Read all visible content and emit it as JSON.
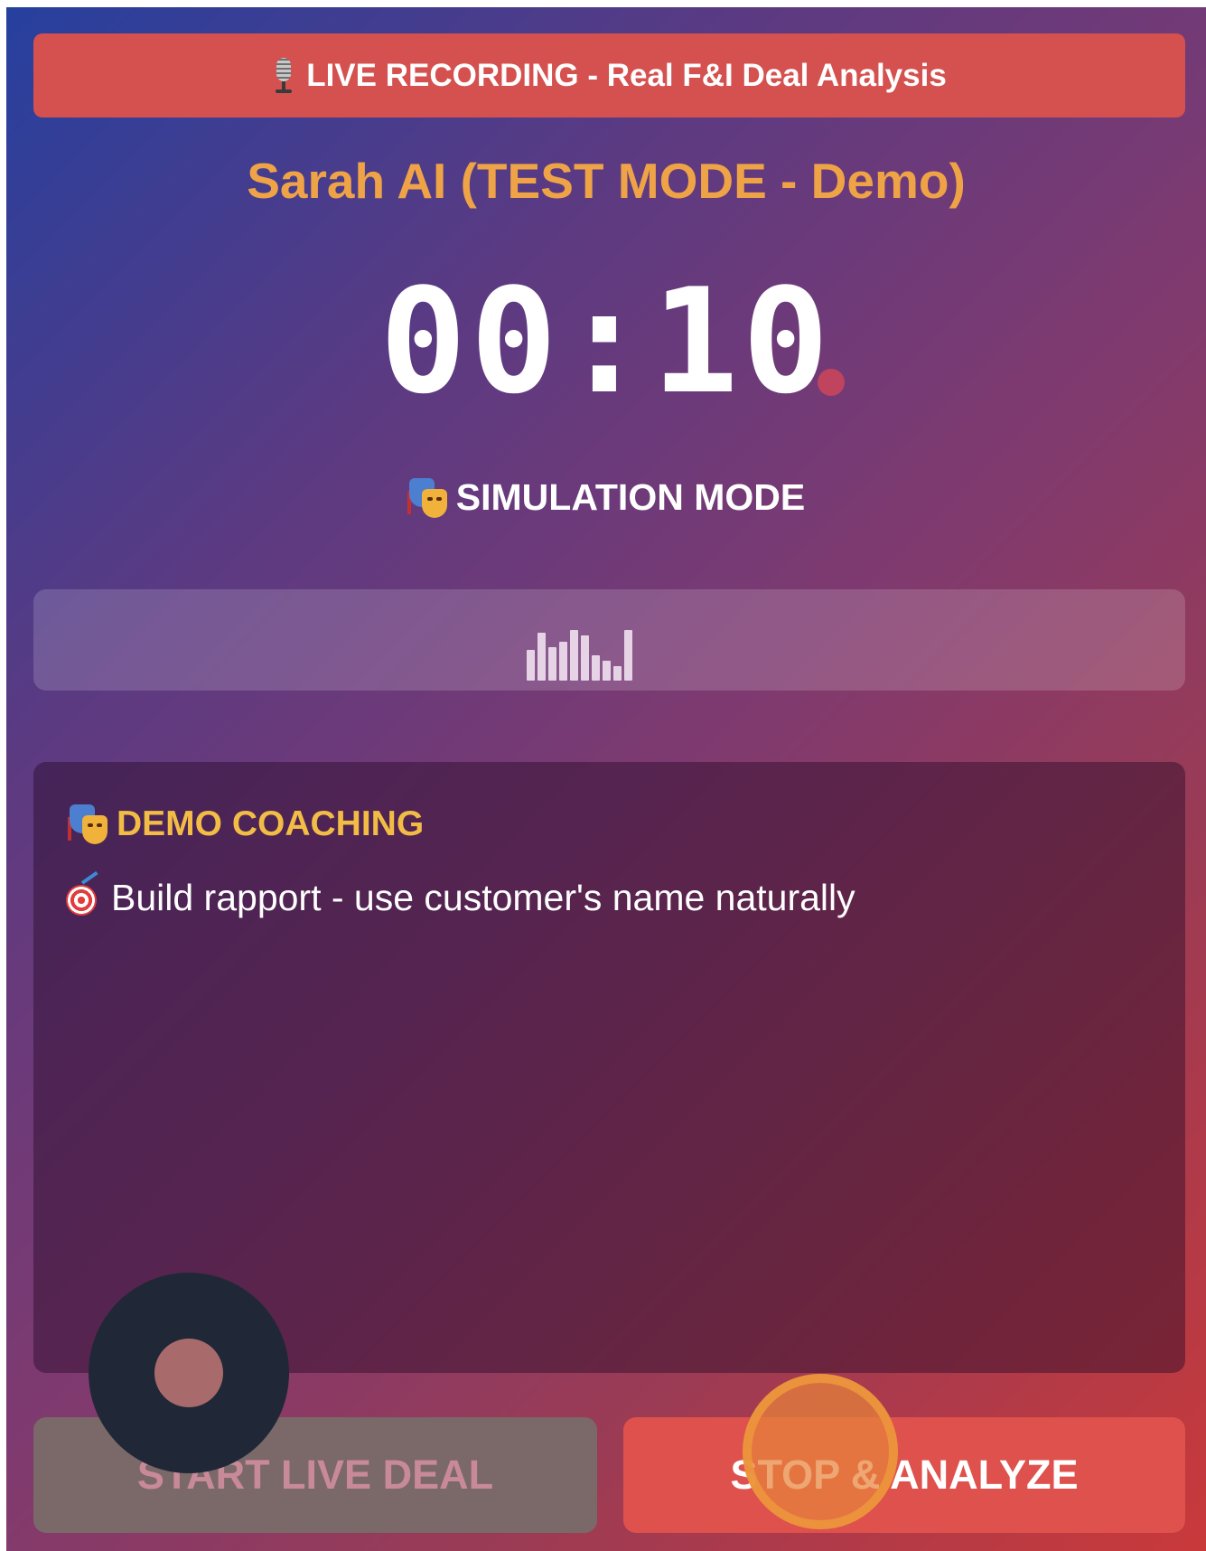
{
  "banner": {
    "icon": "microphone-icon",
    "text": "LIVE RECORDING - Real F&I Deal Analysis",
    "color": "#d4514f"
  },
  "agent": {
    "title": "Sarah AI (TEST MODE - Demo)",
    "color": "#efa347"
  },
  "timer": {
    "value": "00:10",
    "recording_indicator": "recording-dot"
  },
  "mode": {
    "icon": "performing-arts-masks-icon",
    "label": "SIMULATION MODE"
  },
  "audio_meter": {
    "levels": [
      0.55,
      0.85,
      0.6,
      0.7,
      0.9,
      0.8,
      0.45,
      0.35,
      0.25,
      0.9
    ]
  },
  "coaching": {
    "icon": "performing-arts-masks-icon",
    "title": "DEMO COACHING",
    "tip_icon": "target-dart-icon",
    "tip": "Build rapport - use customer's name naturally"
  },
  "actions": {
    "start_label": "START LIVE DEAL",
    "stop_label": "STOP & ANALYZE",
    "stop_color": "#de514c"
  },
  "fab": {
    "icon": "record-button-icon"
  }
}
